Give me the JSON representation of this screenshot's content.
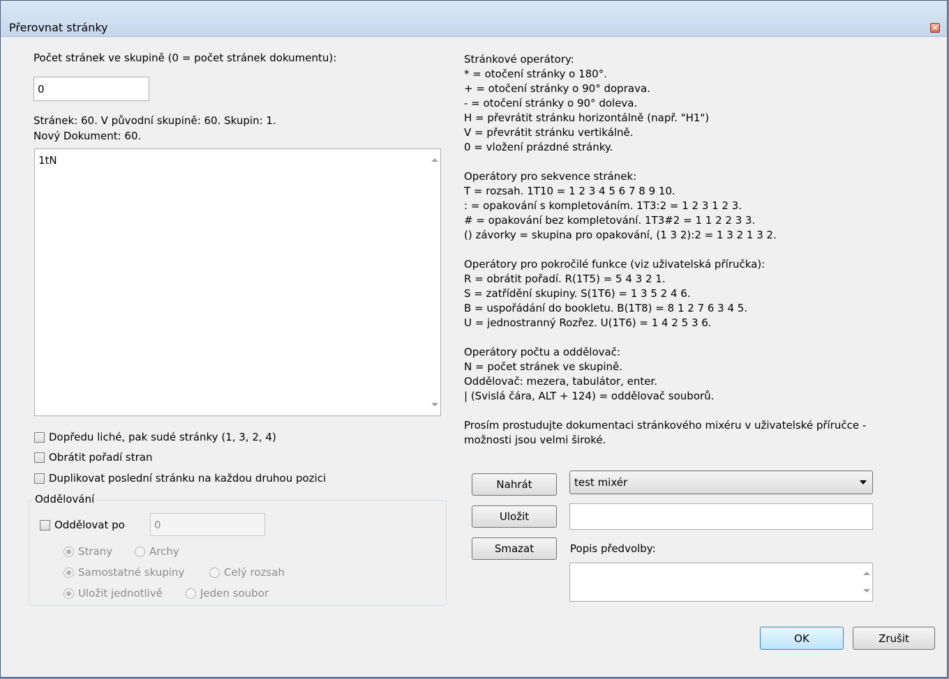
{
  "window": {
    "title": "Přerovnat stránky",
    "close_glyph": "×"
  },
  "left": {
    "pages_label": "Počet stránek ve skupině (0 = počet stránek dokumentu):",
    "pages_value": "0",
    "stats_line1": "Stránek: 60. V původní skupině: 60. Skupin: 1.",
    "stats_line2": "Nový Dokument: 60.",
    "sequence_text": "1tN",
    "options": [
      {
        "label": "Dopředu liché, pak sudé stránky (1, 3, 2, 4)",
        "checked": false
      },
      {
        "label": "Obrátit pořadí stran",
        "checked": false
      },
      {
        "label": "Duplikovat poslední stránku na každou druhou pozici",
        "checked": false
      }
    ],
    "split": {
      "group_title": "Oddělování",
      "split_after_label": "Oddělovat po",
      "split_after_value": "0",
      "radios": [
        {
          "label": "Strany",
          "selected": true
        },
        {
          "label": "Archy",
          "selected": false
        },
        {
          "label": "Samostatné skupiny",
          "selected": true
        },
        {
          "label": "Celý rozsah",
          "selected": false
        },
        {
          "label": "Uložit jednotlivě",
          "selected": true
        },
        {
          "label": "Jeden soubor",
          "selected": false
        }
      ]
    }
  },
  "help": {
    "section1": [
      "Stránkové operátory:",
      "* = otočení stránky o 180°.",
      "+ = otočení stránky o 90° doprava.",
      "- = otočení stránky o 90° doleva.",
      "H = převrátit stránku horizontálně (např. \"H1\")",
      "V = převrátit stránku vertikálně.",
      "0 = vložení prázdné stránky."
    ],
    "section2": [
      "Operátory pro sekvence stránek:",
      "T = rozsah. 1T10 = 1 2 3 4 5 6 7 8 9 10.",
      ": = opakování s kompletováním. 1T3:2 = 1 2 3 1 2 3.",
      "# = opakování bez kompletování. 1T3#2 = 1 1 2 2 3 3.",
      "() závorky = skupina pro opakování, (1 3 2):2 = 1 3 2 1 3 2."
    ],
    "section3": [
      "Operátory pro pokročilé funkce (viz uživatelská příručka):",
      "R = obrátit pořadí. R(1T5) = 5 4 3 2 1.",
      "S = zatřídění skupiny. S(1T6) = 1 3 5 2 4 6.",
      "B = uspořádání do bookletu. B(1T8) = 8 1 2 7 6 3 4 5.",
      "U = jednostranný Rozřez. U(1T6) = 1 4 2 5 3 6."
    ],
    "section4": [
      "Operátory počtu a oddělovač:",
      "N = počet stránek ve skupině.",
      "Oddělovač: mezera, tabulátor, enter.",
      "| (Svislá čára, ALT + 124) = oddělovač souborů."
    ],
    "note_line1": "Prosím prostudujte dokumentaci stránkového mixéru v uživatelské příručce -",
    "note_line2": "možnosti jsou velmi široké."
  },
  "presets": {
    "load_button": "Nahrát",
    "save_button": "Uložit",
    "delete_button": "Smazat",
    "selected_preset": "test mixér",
    "name_value": "",
    "description_label": "Popis předvolby:",
    "description_value": ""
  },
  "footer": {
    "ok_button": "OK",
    "cancel_button": "Zrušit"
  }
}
